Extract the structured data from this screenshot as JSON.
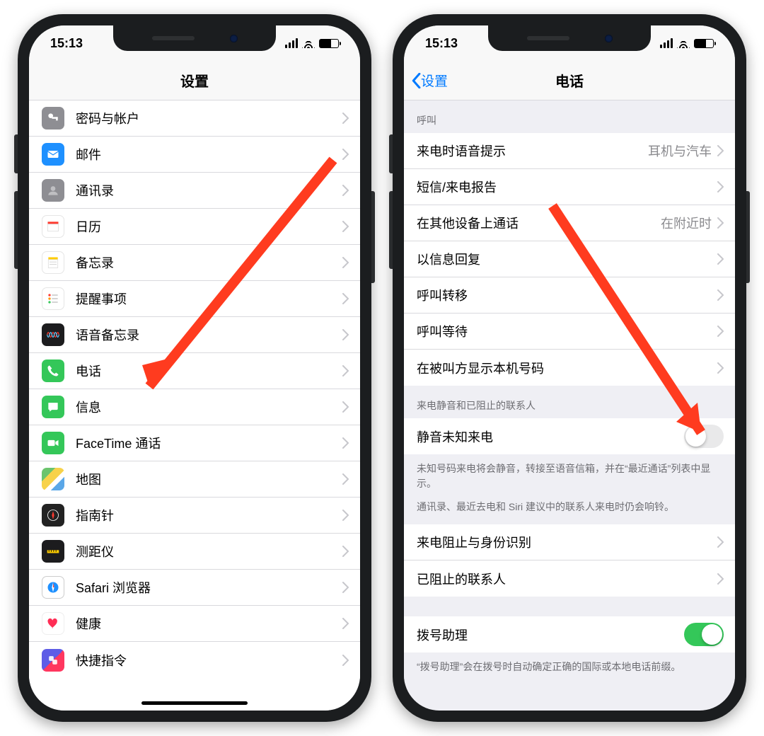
{
  "statusbar": {
    "time": "15:13"
  },
  "left": {
    "title": "设置",
    "rows": [
      {
        "icon": "key-icon",
        "bg": "bg-grey",
        "label": "密码与帐户"
      },
      {
        "icon": "mail-icon",
        "bg": "bg-blue",
        "label": "邮件"
      },
      {
        "icon": "contacts-icon",
        "bg": "bg-teal",
        "label": "通讯录"
      },
      {
        "icon": "calendar-icon",
        "bg": "bg-white",
        "label": "日历"
      },
      {
        "icon": "notes-icon",
        "bg": "bg-white",
        "label": "备忘录"
      },
      {
        "icon": "reminders-icon",
        "bg": "bg-white",
        "label": "提醒事项"
      },
      {
        "icon": "voicememo-icon",
        "bg": "bg-dark",
        "label": "语音备忘录"
      },
      {
        "icon": "phone-icon",
        "bg": "bg-green",
        "label": "电话"
      },
      {
        "icon": "messages-icon",
        "bg": "bg-green",
        "label": "信息"
      },
      {
        "icon": "facetime-icon",
        "bg": "bg-green",
        "label": "FaceTime 通话"
      },
      {
        "icon": "maps-icon",
        "bg": "bg-maps",
        "label": "地图"
      },
      {
        "icon": "compass-icon",
        "bg": "bg-compass",
        "label": "指南针"
      },
      {
        "icon": "measure-icon",
        "bg": "bg-dark",
        "label": "测距仪"
      },
      {
        "icon": "safari-icon",
        "bg": "bg-safari",
        "label": "Safari 浏览器"
      },
      {
        "icon": "health-icon",
        "bg": "bg-health",
        "label": "健康"
      },
      {
        "icon": "shortcuts-icon",
        "bg": "bg-shortcuts",
        "label": "快捷指令"
      }
    ]
  },
  "right": {
    "back": "设置",
    "title": "电话",
    "group1_header": "呼叫",
    "group1": [
      {
        "label": "来电时语音提示",
        "detail": "耳机与汽车"
      },
      {
        "label": "短信/来电报告",
        "detail": ""
      },
      {
        "label": "在其他设备上通话",
        "detail": "在附近时"
      },
      {
        "label": "以信息回复",
        "detail": ""
      },
      {
        "label": "呼叫转移",
        "detail": ""
      },
      {
        "label": "呼叫等待",
        "detail": ""
      },
      {
        "label": "在被叫方显示本机号码",
        "detail": ""
      }
    ],
    "group2_header": "来电静音和已阻止的联系人",
    "silence": {
      "label": "静音未知来电",
      "on": false
    },
    "silence_footer1": "未知号码来电将会静音，转接至语音信箱，并在“最近通话”列表中显示。",
    "silence_footer2": "通讯录、最近去电和 Siri 建议中的联系人来电时仍会响铃。",
    "group3": [
      {
        "label": "来电阻止与身份识别"
      },
      {
        "label": "已阻止的联系人"
      }
    ],
    "dial_assist": {
      "label": "拨号助理",
      "on": true
    },
    "dial_assist_footer": "“拨号助理”会在拨号时自动确定正确的国际或本地电话前缀。"
  }
}
